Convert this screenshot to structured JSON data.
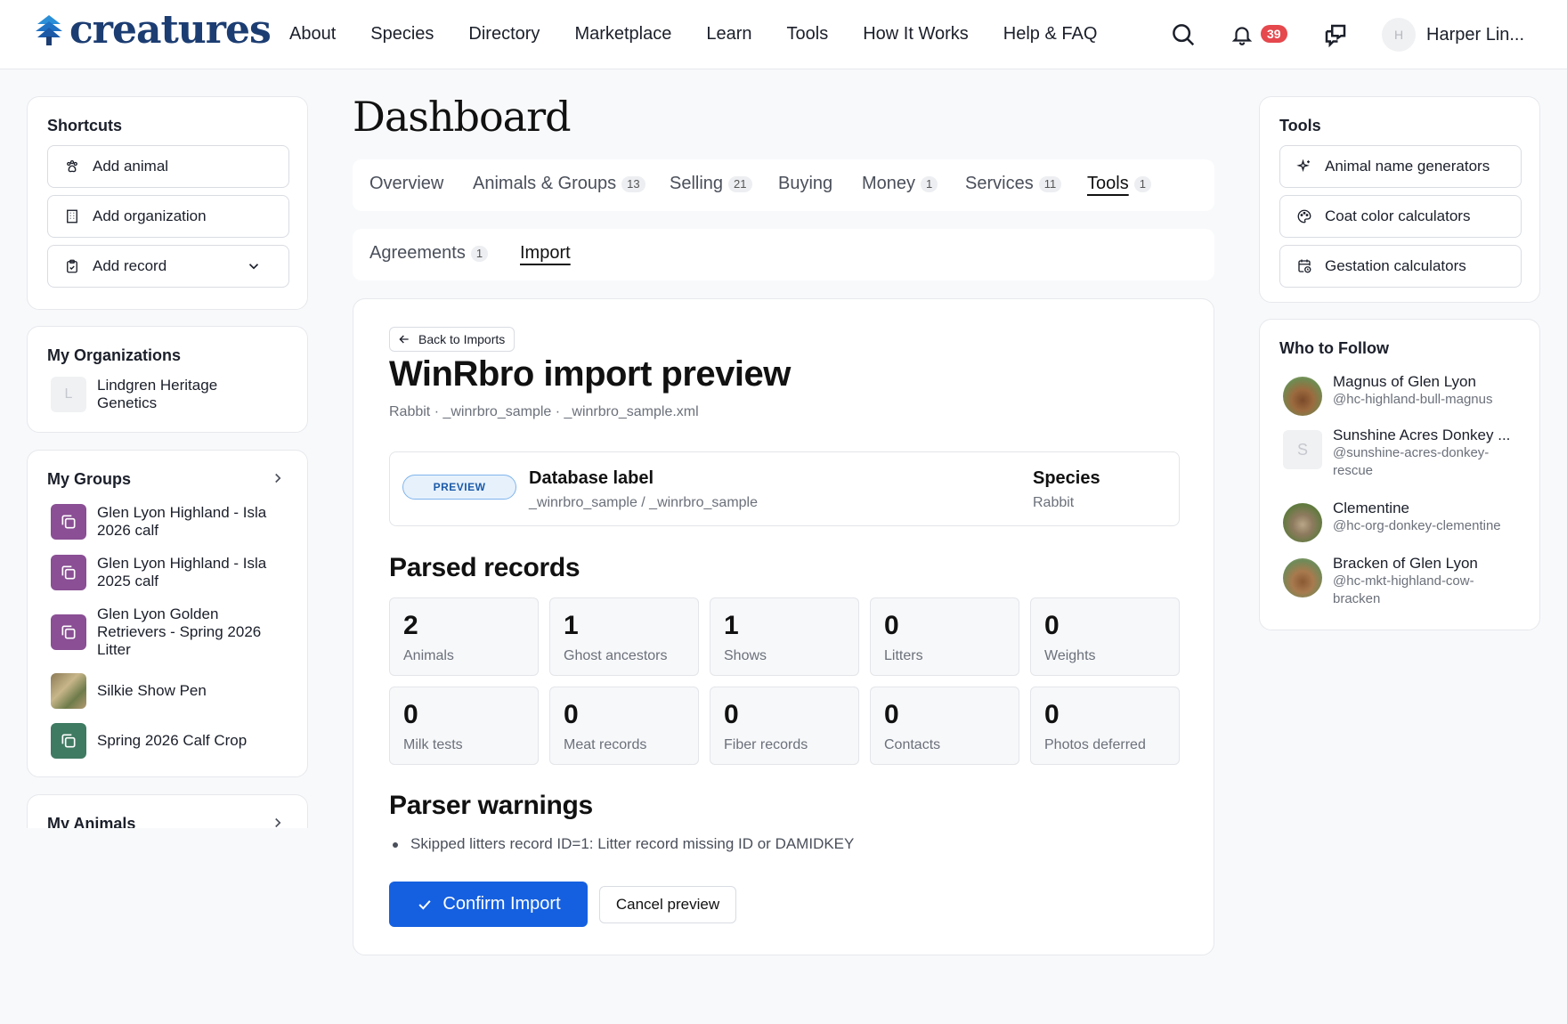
{
  "brand": {
    "name": "creatures",
    "color": "#1c3d72"
  },
  "nav": [
    "About",
    "Species",
    "Directory",
    "Marketplace",
    "Learn",
    "Tools",
    "How It Works",
    "Help & FAQ"
  ],
  "header": {
    "notification_count": "39",
    "user_initial": "H",
    "user_name": "Harper Lin..."
  },
  "shortcuts": {
    "title": "Shortcuts",
    "items": [
      {
        "label": "Add animal",
        "icon": "paw-icon"
      },
      {
        "label": "Add organization",
        "icon": "building-icon"
      },
      {
        "label": "Add record",
        "icon": "clipboard-icon"
      }
    ]
  },
  "organizations": {
    "title": "My Organizations",
    "items": [
      {
        "initial": "L",
        "name": "Lindgren Heritage Genetics"
      }
    ]
  },
  "groups": {
    "title": "My Groups",
    "items": [
      {
        "name": "Glen Lyon Highland - Isla 2026 calf",
        "color": "#8a4f94"
      },
      {
        "name": "Glen Lyon Highland - Isla 2025 calf",
        "color": "#8a4f94"
      },
      {
        "name": "Glen Lyon Golden Retrievers - Spring 2026 Litter",
        "color": "#8a4f94"
      },
      {
        "name": "Silkie Show Pen",
        "color": "photo"
      },
      {
        "name": "Spring 2026 Calf Crop",
        "color": "#3f7a62"
      }
    ]
  },
  "animals": {
    "title": "My Animals"
  },
  "page": {
    "title": "Dashboard"
  },
  "tabs": [
    {
      "label": "Overview",
      "count": ""
    },
    {
      "label": "Animals & Groups",
      "count": "13"
    },
    {
      "label": "Selling",
      "count": "21"
    },
    {
      "label": "Buying",
      "count": ""
    },
    {
      "label": "Money",
      "count": "1"
    },
    {
      "label": "Services",
      "count": "11"
    },
    {
      "label": "Tools",
      "count": "1"
    }
  ],
  "subtabs": [
    {
      "label": "Agreements",
      "count": "1"
    },
    {
      "label": "Import",
      "count": ""
    }
  ],
  "import": {
    "back_label": "Back to Imports",
    "title": "WinRbro import preview",
    "subtitle": "Rabbit · _winrbro_sample · _winrbro_sample.xml",
    "badge": "PREVIEW",
    "db_label_title": "Database label",
    "db_label_value": "_winrbro_sample / _winrbro_sample",
    "species_title": "Species",
    "species_value": "Rabbit",
    "parsed_title": "Parsed records",
    "stats": [
      {
        "value": "2",
        "label": "Animals"
      },
      {
        "value": "1",
        "label": "Ghost ancestors"
      },
      {
        "value": "1",
        "label": "Shows"
      },
      {
        "value": "0",
        "label": "Litters"
      },
      {
        "value": "0",
        "label": "Weights"
      },
      {
        "value": "0",
        "label": "Milk tests"
      },
      {
        "value": "0",
        "label": "Meat records"
      },
      {
        "value": "0",
        "label": "Fiber records"
      },
      {
        "value": "0",
        "label": "Contacts"
      },
      {
        "value": "0",
        "label": "Photos deferred"
      }
    ],
    "warnings_title": "Parser warnings",
    "warnings": [
      "Skipped litters record ID=1: Litter record missing ID or DAMIDKEY"
    ],
    "confirm_label": "Confirm Import",
    "cancel_label": "Cancel preview"
  },
  "tools": {
    "title": "Tools",
    "items": [
      {
        "label": "Animal name generators",
        "icon": "sparkle-icon"
      },
      {
        "label": "Coat color calculators",
        "icon": "palette-icon"
      },
      {
        "label": "Gestation calculators",
        "icon": "calendar-clock-icon"
      }
    ]
  },
  "follow": {
    "title": "Who to Follow",
    "items": [
      {
        "name": "Magnus of Glen Lyon",
        "handle": "@hc-highland-bull-magnus"
      },
      {
        "name": "Sunshine Acres Donkey ...",
        "handle": "@sunshine-acres-donkey-rescue",
        "initial": "S"
      },
      {
        "name": "Clementine",
        "handle": "@hc-org-donkey-clementine"
      },
      {
        "name": "Bracken of Glen Lyon",
        "handle": "@hc-mkt-highland-cow-bracken"
      }
    ]
  },
  "colors": {
    "primary": "#1560e0",
    "notification": "#e5484d"
  }
}
